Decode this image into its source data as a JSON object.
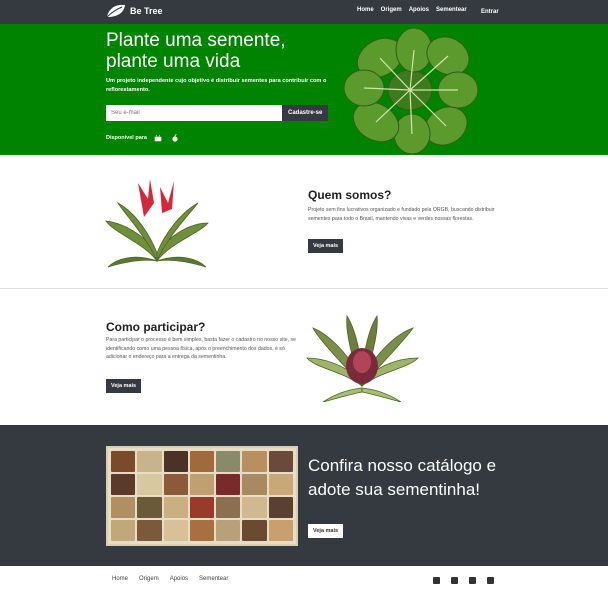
{
  "nav": {
    "brand": "Be Tree",
    "links": [
      "Home",
      "Origem",
      "Apoios",
      "Sementear"
    ],
    "enter_label": "Entrar"
  },
  "hero": {
    "title": "Plante uma semente, plante uma vida",
    "lead": "Um projeto independente cujo objetivo é distribuir sementes para contribuir com o reflorestamento.",
    "email_placeholder": "Seu e-mail",
    "signup_label": "Cadastre-se",
    "available_label": "Disponível para"
  },
  "about": {
    "title": "Quem somos?",
    "text": "Projeto sem fins lucrativos organizado e fundado pela ORGB, buscando distribuir sementes para todo o Brasil, mantendo vivas e verdes nossas florestas.",
    "button": "Veja mais"
  },
  "participate": {
    "title": "Como participar?",
    "text": "Para participar o processo é bem simples, basta fazer o cadastro no nosso site, se identificando como uma pessoa física, após o preenchimento dos dados, é só adicionar o endereço para a entrega da sementinha.",
    "button": "Veja mais"
  },
  "catalog": {
    "title": "Confira nosso catálogo e adote sua sementinha!",
    "button": "Veja mais"
  },
  "footer": {
    "links": [
      "Home",
      "Origem",
      "Apoios",
      "Sementear"
    ],
    "social": [
      "facebook-icon",
      "twitter-icon",
      "instagram-icon",
      "youtube-icon"
    ]
  },
  "colors": {
    "dark": "#343a40",
    "green": "#008400"
  }
}
